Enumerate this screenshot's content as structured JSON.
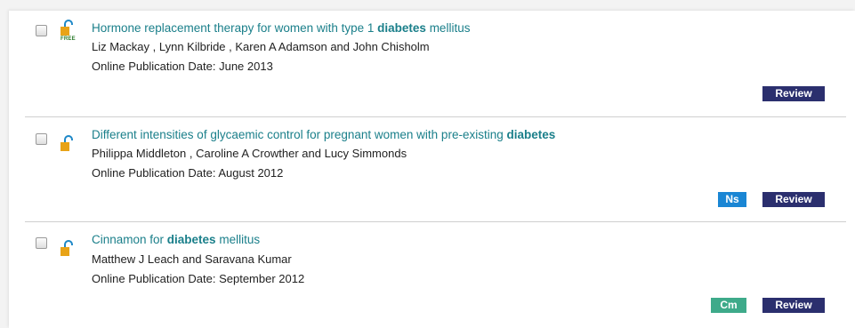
{
  "results": [
    {
      "title_pre": "Hormone replacement therapy for women with type 1 ",
      "title_keyword": "diabetes",
      "title_post": " mellitus",
      "authors": "Liz Mackay , Lynn Kilbride , Karen A Adamson and John Chisholm",
      "pub_date": "Online Publication Date: June 2013",
      "free_label": "FREE",
      "badges": {
        "review": "Review"
      }
    },
    {
      "title_pre": "Different intensities of glycaemic control for pregnant women with pre-existing ",
      "title_keyword": "diabetes",
      "title_post": "",
      "authors": "Philippa Middleton , Caroline A Crowther and Lucy Simmonds",
      "pub_date": "Online Publication Date: August 2012",
      "badges": {
        "ns": "Ns",
        "review": "Review"
      }
    },
    {
      "title_pre": "Cinnamon for ",
      "title_keyword": "diabetes",
      "title_post": " mellitus",
      "authors": "Matthew J Leach and Saravana Kumar",
      "pub_date": "Online Publication Date: September 2012",
      "badges": {
        "cm": "Cm",
        "review": "Review"
      }
    }
  ],
  "icons": {
    "checkbox": "checkbox",
    "lock": "open-access-lock-icon"
  },
  "colors": {
    "link": "#1a7f8a",
    "review": "#2b2f6e",
    "ns": "#1a86d4",
    "cm": "#3eaa8a",
    "lock": "#e8a317"
  }
}
